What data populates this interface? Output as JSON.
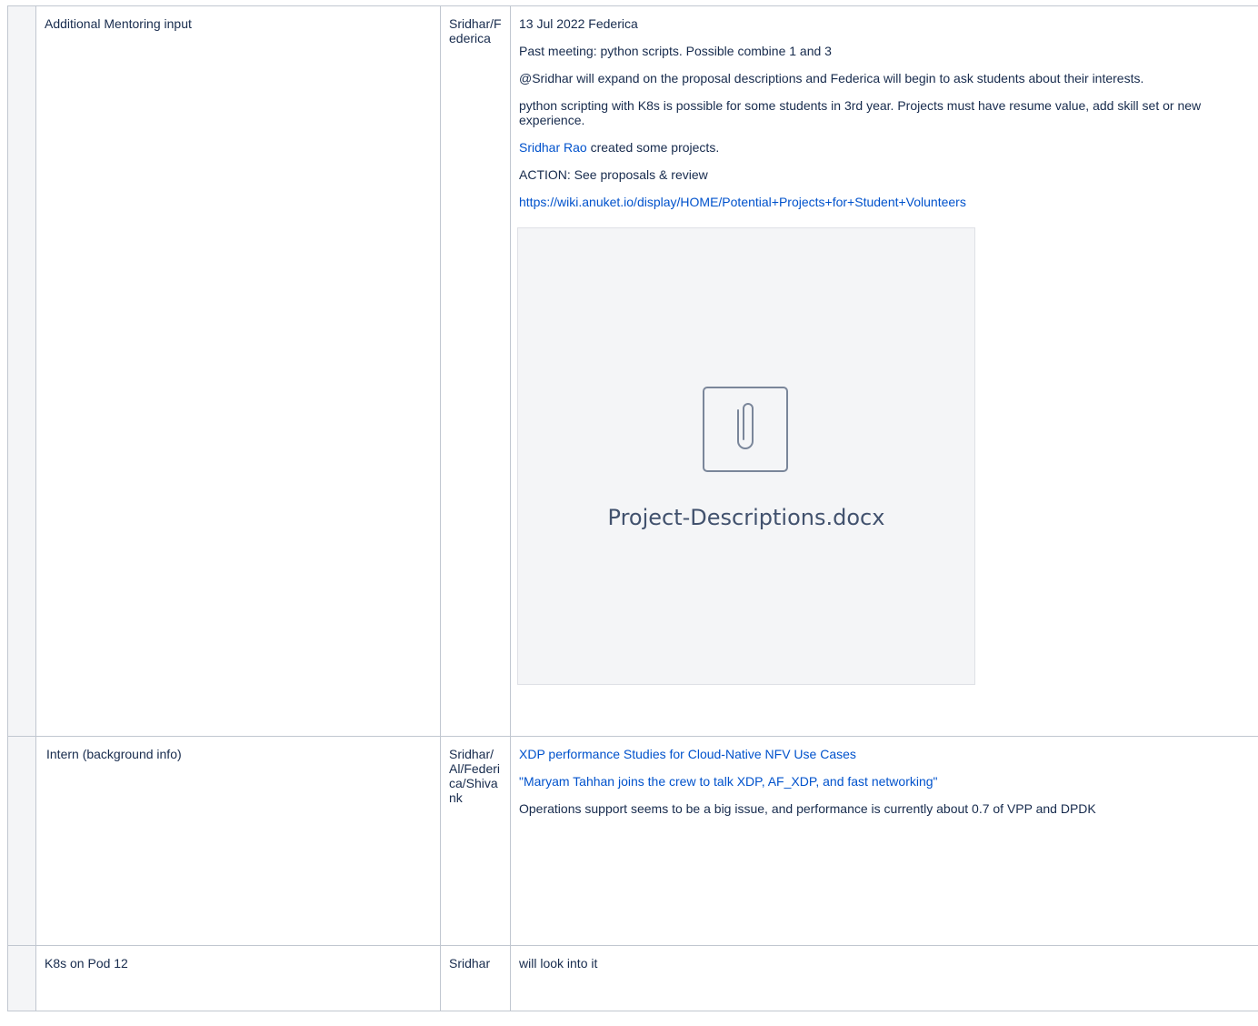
{
  "rows": [
    {
      "topic": "Additional Mentoring input",
      "who": "Sridhar/Federica",
      "notes": {
        "date_line": "13 Jul 2022  Federica",
        "p1": "Past meeting: python scripts.  Possible combine 1 and 3",
        "p2": "@Sridhar will expand on the proposal descriptions and Federica will begin to ask students about their interests.",
        "p3": "python scripting with K8s is possible for some students in 3rd year. Projects must have resume value, add skill set or new experience.",
        "mention": "Sridhar Rao",
        "mention_suffix": " created some projects.",
        "action": "ACTION: See proposals & review",
        "link": "https://wiki.anuket.io/display/HOME/Potential+Projects+for+Student+Volunteers",
        "attachment": "Project-Descriptions.docx"
      }
    },
    {
      "topic": "Intern (background info)",
      "who": "Sridhar/Al/Federica/Shivank",
      "notes": {
        "link1": "XDP performance Studies for Cloud-Native NFV Use Cases",
        "link2": "\"Maryam Tahhan joins the crew to talk XDP, AF_XDP, and fast networking\"",
        "p1": "Operations support seems to be a big issue, and performance is currently about 0.7 of VPP and DPDK"
      }
    },
    {
      "topic": "K8s on Pod 12",
      "who": "Sridhar",
      "notes": {
        "p1": "will look into it"
      }
    }
  ],
  "icons": {
    "attachment": "paperclip-icon"
  },
  "colors": {
    "link": "#0052cc",
    "border": "#c1c7d0",
    "attachment_bg": "#f4f5f7"
  }
}
